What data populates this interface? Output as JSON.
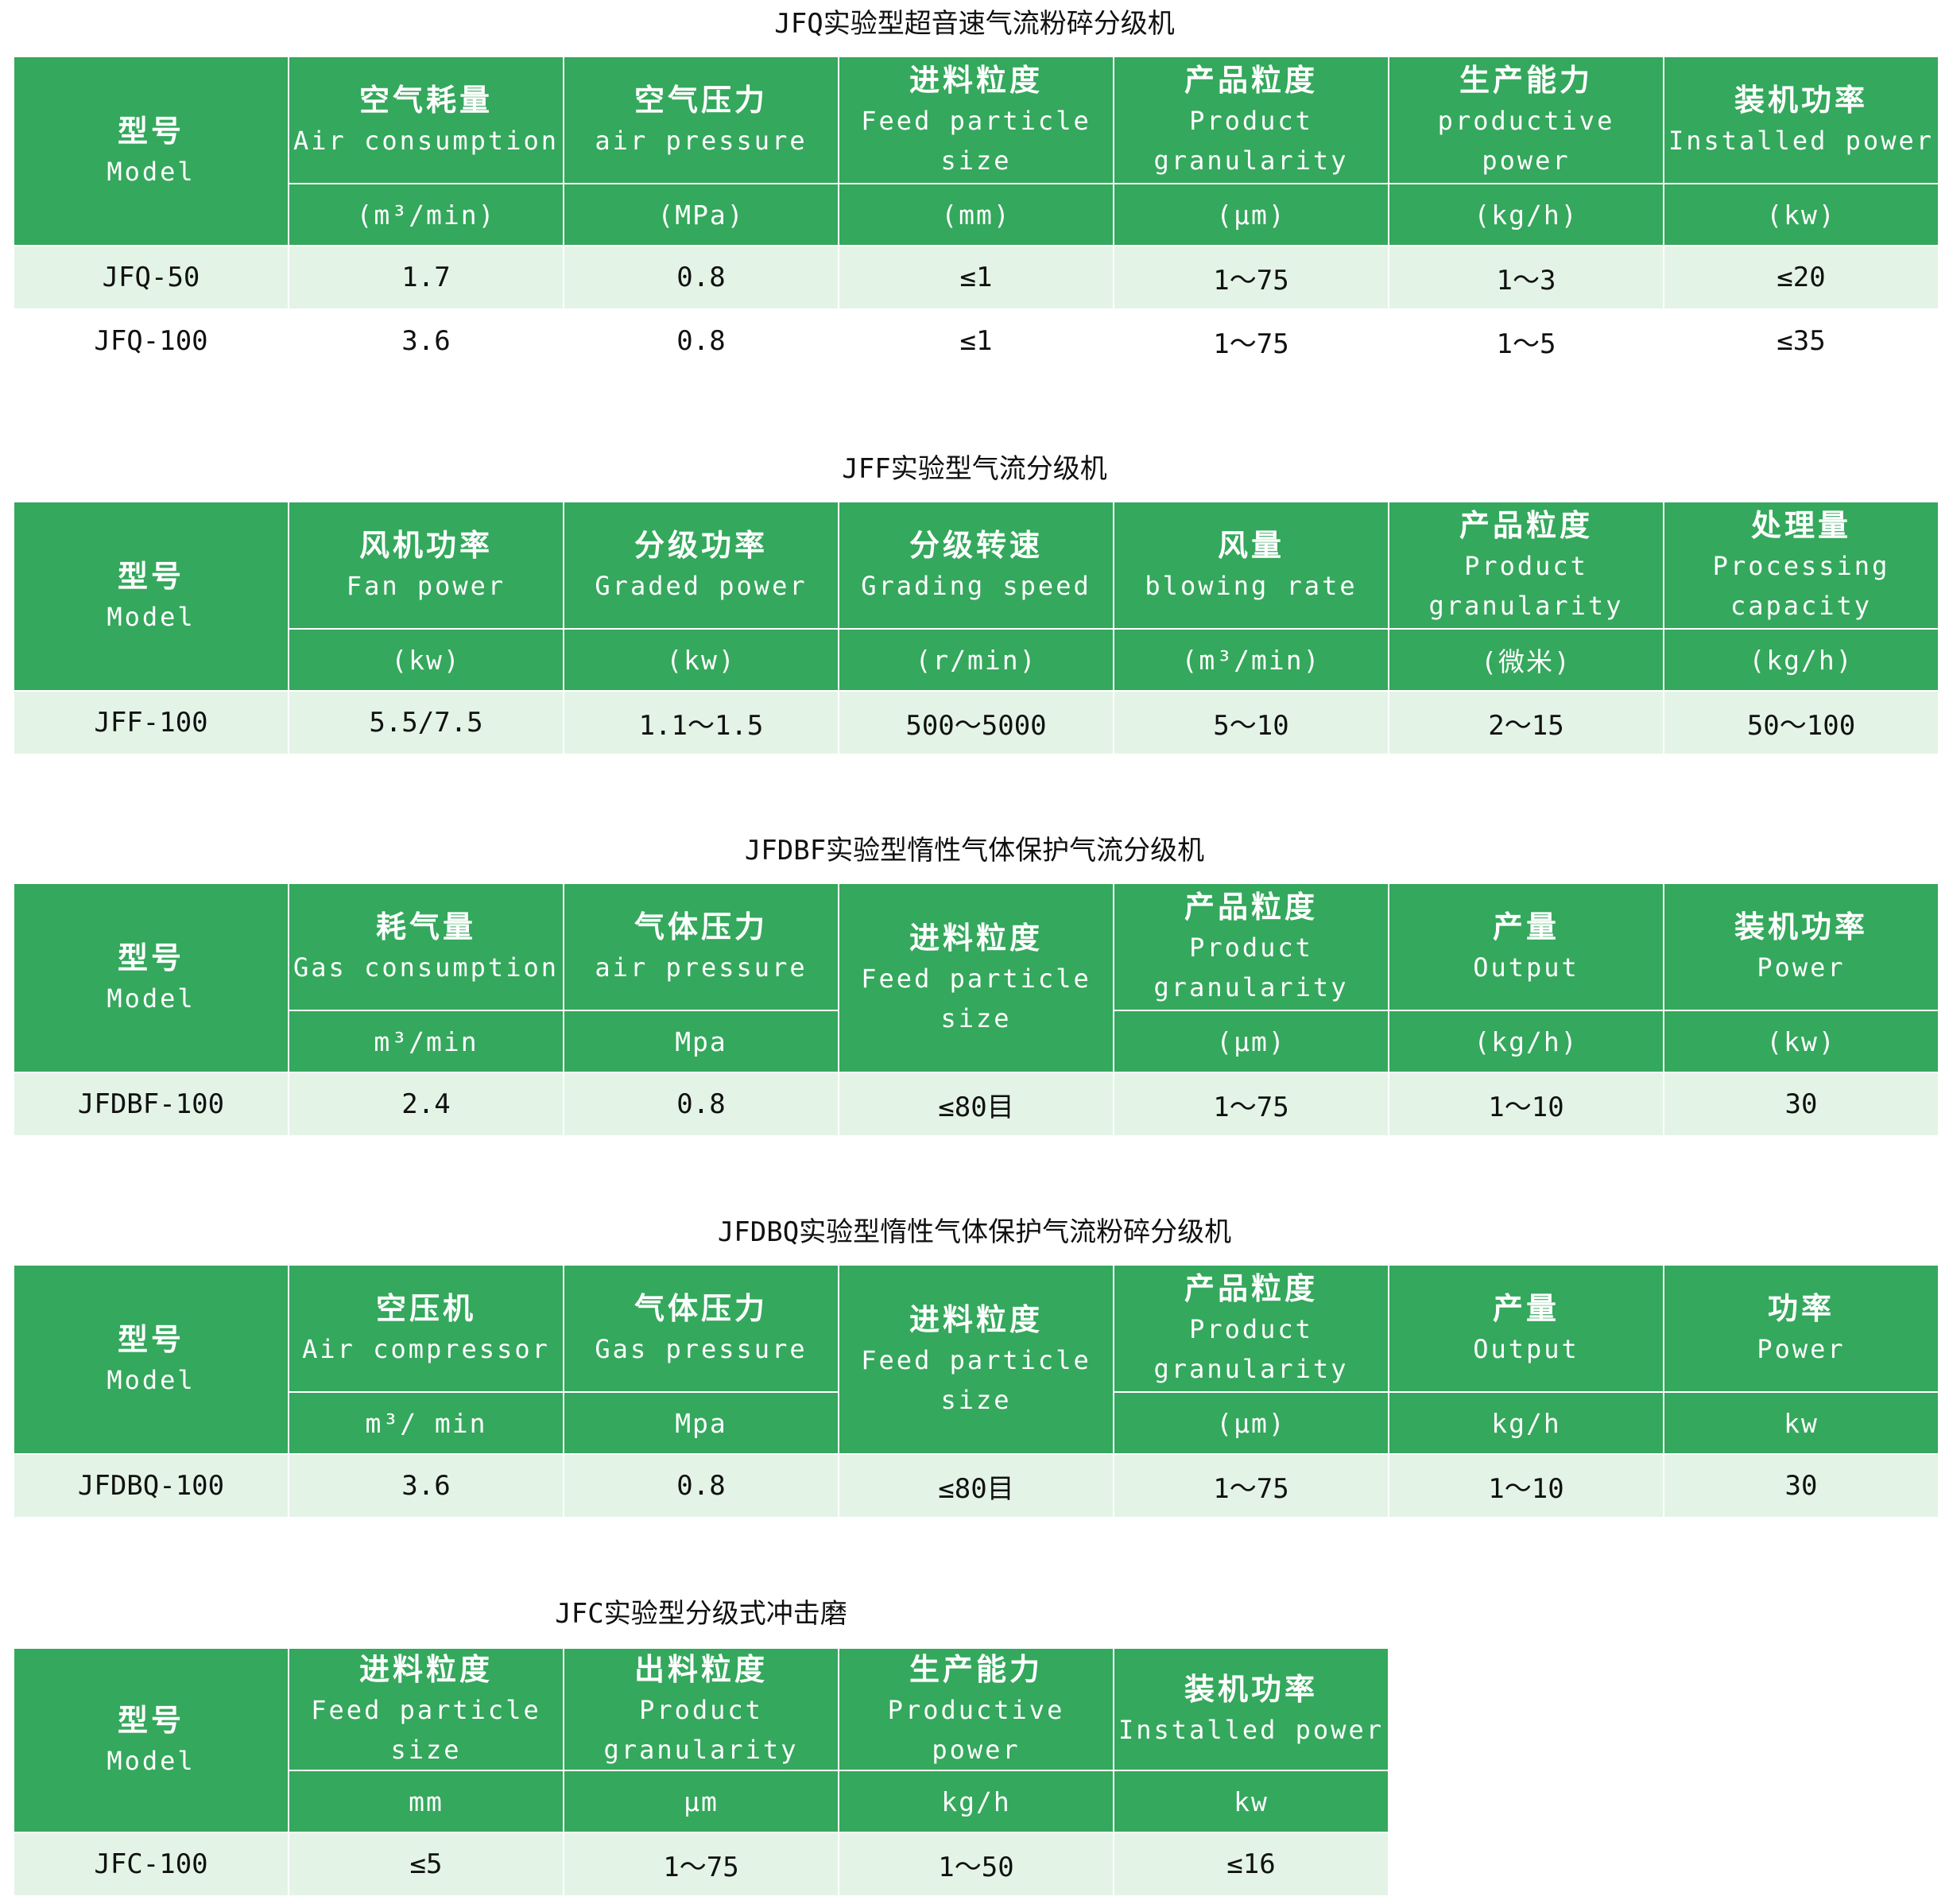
{
  "tables": [
    {
      "title": "JFQ实验型超音速气流粉碎分级机",
      "model_zh": "型号",
      "model_en": "Model",
      "columns": [
        {
          "zh": "空气耗量",
          "en": "Air consumption",
          "unit": "(m³/min)"
        },
        {
          "zh": "空气压力",
          "en": "air pressure",
          "unit": "(MPa)"
        },
        {
          "zh": "进料粒度",
          "en": "Feed particle size",
          "unit": "(mm)"
        },
        {
          "zh": "产品粒度",
          "en": "Product granularity",
          "unit": "(μm)"
        },
        {
          "zh": "生产能力",
          "en": "productive power",
          "unit": "(kg/h)"
        },
        {
          "zh": "装机功率",
          "en": "Installed power",
          "unit": "(kw)"
        }
      ],
      "rows": [
        [
          "JFQ-50",
          "1.7",
          "0.8",
          "≤1",
          "1～75",
          "1～3",
          "≤20"
        ],
        [
          "JFQ-100",
          "3.6",
          "0.8",
          "≤1",
          "1～75",
          "1～5",
          "≤35"
        ]
      ]
    },
    {
      "title": "JFF实验型气流分级机",
      "model_zh": "型号",
      "model_en": "Model",
      "columns": [
        {
          "zh": "风机功率",
          "en": "Fan power",
          "unit": "(kw)"
        },
        {
          "zh": "分级功率",
          "en": "Graded power",
          "unit": "(kw)"
        },
        {
          "zh": "分级转速",
          "en": "Grading speed",
          "unit": "(r/min)"
        },
        {
          "zh": "风量",
          "en": "blowing rate",
          "unit": "(m³/min)"
        },
        {
          "zh": "产品粒度",
          "en": "Product granularity",
          "unit": "(微米)"
        },
        {
          "zh": "处理量",
          "en": "Processing capacity",
          "unit": "(kg/h)"
        }
      ],
      "rows": [
        [
          "JFF-100",
          "5.5/7.5",
          "1.1～1.5",
          "500～5000",
          "5～10",
          "2～15",
          "50～100"
        ]
      ]
    },
    {
      "title": "JFDBF实验型惰性气体保护气流分级机",
      "model_zh": "型号",
      "model_en": "Model",
      "columns": [
        {
          "zh": "耗气量",
          "en": "Gas consumption",
          "unit": "m³/min"
        },
        {
          "zh": "气体压力",
          "en": "air pressure",
          "unit": "Mpa"
        },
        {
          "zh": "进料粒度",
          "en": "Feed particle size",
          "unit": ""
        },
        {
          "zh": "产品粒度",
          "en": "Product granularity",
          "unit": "(μm)"
        },
        {
          "zh": "产量",
          "en": "Output",
          "unit": "(kg/h)"
        },
        {
          "zh": "装机功率",
          "en": "Power",
          "unit": "(kw)"
        }
      ],
      "rows": [
        [
          "JFDBF-100",
          "2.4",
          "0.8",
          "≤80目",
          "1～75",
          "1～10",
          "30"
        ]
      ]
    },
    {
      "title": "JFDBQ实验型惰性气体保护气流粉碎分级机",
      "model_zh": "型号",
      "model_en": "Model",
      "columns": [
        {
          "zh": "空压机",
          "en": "Air compressor",
          "unit": "m³/ min"
        },
        {
          "zh": "气体压力",
          "en": "Gas pressure",
          "unit": "Mpa"
        },
        {
          "zh": "进料粒度",
          "en": "Feed particle size",
          "unit": ""
        },
        {
          "zh": "产品粒度",
          "en": "Product granularity",
          "unit": "(μm)"
        },
        {
          "zh": "产量",
          "en": "Output",
          "unit": "kg/h"
        },
        {
          "zh": "功率",
          "en": "Power",
          "unit": "kw"
        }
      ],
      "rows": [
        [
          "JFDBQ-100",
          "3.6",
          "0.8",
          "≤80目",
          "1～75",
          "1～10",
          "30"
        ]
      ]
    },
    {
      "title": "JFC实验型分级式冲击磨",
      "model_zh": "型号",
      "model_en": "Model",
      "columns": [
        {
          "zh": "进料粒度",
          "en": "Feed particle size",
          "unit": "mm"
        },
        {
          "zh": "出料粒度",
          "en": "Product granularity",
          "unit": "μm"
        },
        {
          "zh": "生产能力",
          "en": "Productive power",
          "unit": "kg/h"
        },
        {
          "zh": "装机功率",
          "en": "Installed power",
          "unit": "kw"
        }
      ],
      "rows": [
        [
          "JFC-100",
          "≤5",
          "1～75",
          "1～50",
          "≤16"
        ]
      ]
    }
  ]
}
